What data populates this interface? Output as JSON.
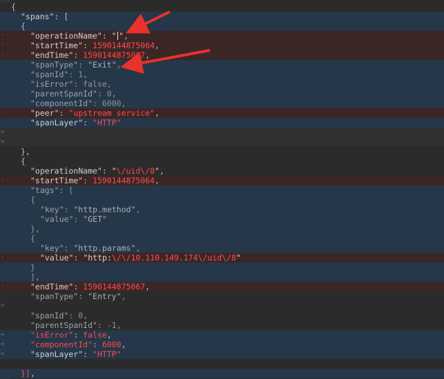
{
  "editor": {
    "gutter_marks": {
      "dot": "·",
      "fold": ">",
      "change": "≈"
    },
    "lines": [
      {
        "row": 0,
        "bg": "bg-dark",
        "mark": "",
        "indent": 0,
        "parts": [
          [
            "p",
            "{"
          ]
        ]
      },
      {
        "row": 1,
        "bg": "bg-blue",
        "mark": "",
        "indent": 1,
        "parts": [
          [
            "k",
            "\"spans\""
          ],
          [
            "p",
            ": ["
          ]
        ]
      },
      {
        "row": 2,
        "bg": "bg-blue",
        "mark": "",
        "indent": 1,
        "parts": [
          [
            "p",
            "{"
          ]
        ]
      },
      {
        "row": 3,
        "bg": "bg-red",
        "mark": "dot",
        "indent": 2,
        "parts": [
          [
            "k",
            "\"operationName\""
          ],
          [
            "p",
            ": "
          ],
          [
            "s",
            "\""
          ],
          [
            "cursor",
            ""
          ],
          [
            "s",
            "\""
          ],
          [
            "p",
            ","
          ]
        ]
      },
      {
        "row": 4,
        "bg": "bg-red",
        "mark": "dot",
        "indent": 2,
        "parts": [
          [
            "k",
            "\"startTime\""
          ],
          [
            "p",
            ": "
          ],
          [
            "n",
            "1590144875064"
          ],
          [
            "p",
            ","
          ]
        ]
      },
      {
        "row": 5,
        "bg": "bg-red",
        "mark": "dot",
        "indent": 2,
        "parts": [
          [
            "k",
            "\"endTime\""
          ],
          [
            "p",
            ": "
          ],
          [
            "n",
            "1590144875067"
          ],
          [
            "p",
            ","
          ]
        ]
      },
      {
        "row": 6,
        "bg": "bg-blue",
        "mark": "",
        "indent": 2,
        "parts": [
          [
            "kd",
            "\"spanType\""
          ],
          [
            "pd",
            ": "
          ],
          [
            "sd",
            "\"Exit\""
          ],
          [
            "pd",
            ","
          ]
        ]
      },
      {
        "row": 7,
        "bg": "bg-blue",
        "mark": "",
        "indent": 2,
        "parts": [
          [
            "kd",
            "\"spanId\""
          ],
          [
            "pd",
            ": 1,"
          ]
        ]
      },
      {
        "row": 8,
        "bg": "bg-blue",
        "mark": "",
        "indent": 2,
        "parts": [
          [
            "kd",
            "\"isError\""
          ],
          [
            "pd",
            ": false,"
          ]
        ]
      },
      {
        "row": 9,
        "bg": "bg-blue",
        "mark": "",
        "indent": 2,
        "parts": [
          [
            "kd",
            "\"parentSpanId\""
          ],
          [
            "pd",
            ": 0,"
          ]
        ]
      },
      {
        "row": 10,
        "bg": "bg-blue",
        "mark": "",
        "indent": 2,
        "parts": [
          [
            "kd",
            "\"componentId\""
          ],
          [
            "pd",
            ": 6000,"
          ]
        ]
      },
      {
        "row": 11,
        "bg": "bg-red",
        "mark": "dot",
        "indent": 2,
        "parts": [
          [
            "k",
            "\"peer\""
          ],
          [
            "p",
            ": "
          ],
          [
            "r",
            "\"upstream service\""
          ],
          [
            "p",
            ","
          ]
        ]
      },
      {
        "row": 12,
        "bg": "bg-blue",
        "mark": "",
        "indent": 2,
        "parts": [
          [
            "k",
            "\"spanLayer\""
          ],
          [
            "p",
            ": "
          ],
          [
            "r",
            "\"HTTP\""
          ]
        ]
      },
      {
        "row": 13,
        "bg": "bg-grey",
        "mark": "fold",
        "indent": 0,
        "parts": []
      },
      {
        "row": 14,
        "bg": "bg-grey",
        "mark": "fold",
        "indent": 0,
        "parts": []
      },
      {
        "row": 15,
        "bg": "bg-dark",
        "mark": "",
        "indent": 1,
        "parts": [
          [
            "p",
            "},"
          ]
        ]
      },
      {
        "row": 16,
        "bg": "bg-dark",
        "mark": "",
        "indent": 1,
        "parts": [
          [
            "p",
            "{"
          ]
        ]
      },
      {
        "row": 17,
        "bg": "bg-dark",
        "mark": "",
        "indent": 2,
        "parts": [
          [
            "k",
            "\"operationName\""
          ],
          [
            "p",
            ": "
          ],
          [
            "s",
            "\""
          ],
          [
            "r",
            "\\/uid\\/8"
          ],
          [
            "s",
            "\""
          ],
          [
            "p",
            ","
          ]
        ]
      },
      {
        "row": 18,
        "bg": "bg-red",
        "mark": "dot",
        "indent": 2,
        "parts": [
          [
            "k",
            "\"startTime\""
          ],
          [
            "p",
            ": "
          ],
          [
            "n",
            "1590144875064"
          ],
          [
            "p",
            ","
          ]
        ]
      },
      {
        "row": 19,
        "bg": "bg-blue",
        "mark": "",
        "indent": 2,
        "parts": [
          [
            "kd",
            "\"tags\""
          ],
          [
            "pd",
            ": ["
          ]
        ]
      },
      {
        "row": 20,
        "bg": "bg-blue",
        "mark": "",
        "indent": 2,
        "parts": [
          [
            "pd",
            "{"
          ]
        ]
      },
      {
        "row": 21,
        "bg": "bg-blue",
        "mark": "",
        "indent": 3,
        "parts": [
          [
            "kd",
            "\"key\""
          ],
          [
            "pd",
            ": "
          ],
          [
            "sd",
            "\"http.method\""
          ],
          [
            "pd",
            ","
          ]
        ]
      },
      {
        "row": 22,
        "bg": "bg-blue",
        "mark": "",
        "indent": 3,
        "parts": [
          [
            "kd",
            "\"value\""
          ],
          [
            "pd",
            ": "
          ],
          [
            "sd",
            "\"GET\""
          ]
        ]
      },
      {
        "row": 23,
        "bg": "bg-blue",
        "mark": "",
        "indent": 2,
        "parts": [
          [
            "pd",
            "},"
          ]
        ]
      },
      {
        "row": 24,
        "bg": "bg-blue",
        "mark": "",
        "indent": 2,
        "parts": [
          [
            "pd",
            "{"
          ]
        ]
      },
      {
        "row": 25,
        "bg": "bg-blue",
        "mark": "",
        "indent": 3,
        "parts": [
          [
            "kd",
            "\"key\""
          ],
          [
            "pd",
            ": "
          ],
          [
            "sd",
            "\"http.params\""
          ],
          [
            "pd",
            ","
          ]
        ]
      },
      {
        "row": 26,
        "bg": "bg-red",
        "mark": "dot",
        "indent": 3,
        "parts": [
          [
            "k",
            "\"value\""
          ],
          [
            "p",
            ": "
          ],
          [
            "s",
            "\"http:"
          ],
          [
            "r",
            "\\/\\/10.110.149.174\\/uid\\/8"
          ],
          [
            "s",
            "\""
          ]
        ]
      },
      {
        "row": 27,
        "bg": "bg-blue",
        "mark": "",
        "indent": 2,
        "parts": [
          [
            "pd",
            "}"
          ]
        ]
      },
      {
        "row": 28,
        "bg": "bg-blue",
        "mark": "",
        "indent": 2,
        "parts": [
          [
            "pd",
            "],"
          ]
        ]
      },
      {
        "row": 29,
        "bg": "bg-red",
        "mark": "dot",
        "indent": 2,
        "parts": [
          [
            "k",
            "\"endTime\""
          ],
          [
            "p",
            ": "
          ],
          [
            "n",
            "1590144875067"
          ],
          [
            "p",
            ","
          ]
        ]
      },
      {
        "row": 30,
        "bg": "bg-dark",
        "mark": "",
        "indent": 2,
        "parts": [
          [
            "kd",
            "\"spanType\""
          ],
          [
            "pd",
            ": "
          ],
          [
            "sd",
            "\"Entry\""
          ],
          [
            "pd",
            ","
          ]
        ]
      },
      {
        "row": 31,
        "bg": "bg-dark",
        "mark": "fold",
        "indent": 0,
        "parts": []
      },
      {
        "row": 32,
        "bg": "bg-dark",
        "mark": "",
        "indent": 2,
        "parts": [
          [
            "kd",
            "\"spanId\""
          ],
          [
            "pd",
            ": 0,"
          ]
        ]
      },
      {
        "row": 33,
        "bg": "bg-dark",
        "mark": "",
        "indent": 2,
        "parts": [
          [
            "kd",
            "\"parentSpanId\""
          ],
          [
            "pd",
            ": -1,"
          ]
        ]
      },
      {
        "row": 34,
        "bg": "bg-blue",
        "mark": "change",
        "indent": 2,
        "parts": [
          [
            "r",
            "\"isError\""
          ],
          [
            "p",
            ": "
          ],
          [
            "r",
            "false"
          ],
          [
            "p",
            ","
          ]
        ]
      },
      {
        "row": 35,
        "bg": "bg-blue",
        "mark": "change",
        "indent": 2,
        "parts": [
          [
            "r",
            "\"componentId\""
          ],
          [
            "p",
            ": "
          ],
          [
            "r",
            "6000"
          ],
          [
            "p",
            ","
          ]
        ]
      },
      {
        "row": 36,
        "bg": "bg-blue",
        "mark": "change",
        "indent": 2,
        "parts": [
          [
            "k",
            "\"spanLayer\""
          ],
          [
            "p",
            ": "
          ],
          [
            "r",
            "\"HTTP\""
          ]
        ]
      },
      {
        "row": 37,
        "bg": "bg-dark",
        "mark": "",
        "indent": 0,
        "parts": []
      },
      {
        "row": 38,
        "bg": "bg-blue",
        "mark": "",
        "indent": 1,
        "parts": [
          [
            "r",
            "}]"
          ],
          [
            "p",
            ","
          ]
        ]
      }
    ]
  },
  "colors": {
    "arrow": "#e8322b"
  }
}
